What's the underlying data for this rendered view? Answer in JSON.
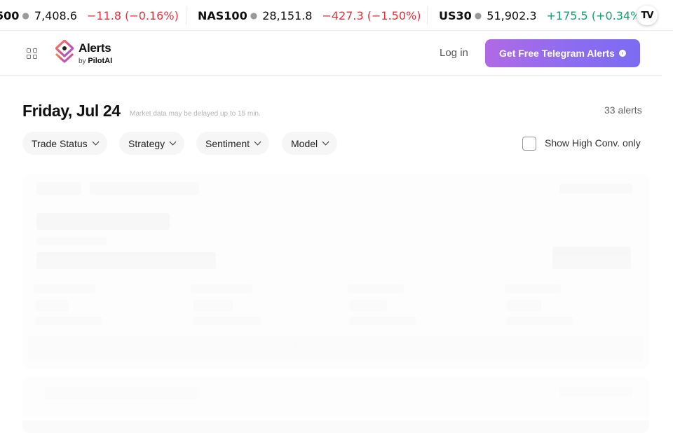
{
  "ticker": [
    {
      "symbol": "500",
      "price": "7,408.6",
      "change": "−11.8 (−0.16%)",
      "direction": "down"
    },
    {
      "symbol": "NAS100",
      "price": "28,151.8",
      "change": "−427.3 (−1.50%)",
      "direction": "down"
    },
    {
      "symbol": "US30",
      "price": "51,902.3",
      "change": "+175.5 (+0.34%)",
      "direction": "up"
    }
  ],
  "ticker_badge": "TV",
  "header": {
    "brand_title": "Alerts",
    "brand_by": "by",
    "brand_company": "PilotAI",
    "login_label": "Log in",
    "cta_label": "Get Free Telegram Alerts"
  },
  "page": {
    "date_title": "Friday, Jul 24",
    "delay_note": "Market data may be delayed up to 15 min.",
    "alert_count": "33 alerts"
  },
  "filters": [
    {
      "label": "Trade Status"
    },
    {
      "label": "Strategy"
    },
    {
      "label": "Sentiment"
    },
    {
      "label": "Model"
    }
  ],
  "high_conv": {
    "label": "Show High Conv. only",
    "checked": false
  },
  "colors": {
    "down": "#e0323c",
    "up": "#14a06b",
    "cta_start": "#b06ae6",
    "cta_end": "#7c6cf2"
  },
  "icons": {
    "apps": "apps-grid-icon",
    "chevron": "chevron-down-icon",
    "cta": "arrow-circle-icon",
    "logo": "pilotai-logo"
  }
}
